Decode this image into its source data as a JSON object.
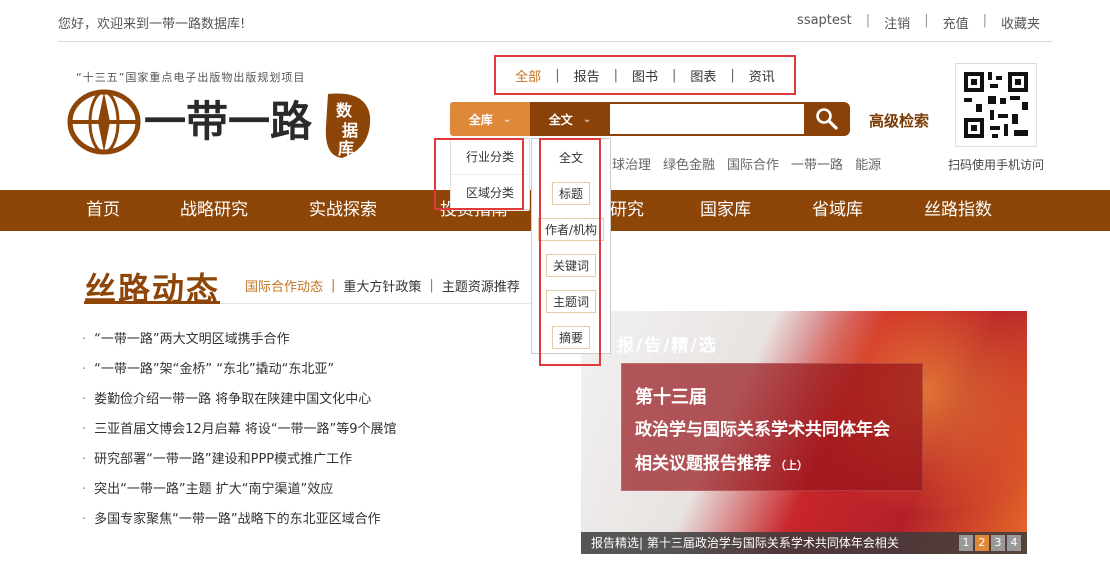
{
  "topbar": {
    "welcome": "您好，欢迎来到一带一路数据库!",
    "links": [
      "ssaptest",
      "注销",
      "充值",
      "收藏夹"
    ]
  },
  "logo": {
    "subtitle": "“十三五”国家重点电子出版物出版规划项目",
    "text": "一带一路",
    "tag": "数据库"
  },
  "search": {
    "types": [
      "全部",
      "报告",
      "图书",
      "图表",
      "资讯"
    ],
    "active_type": "全部",
    "library_label": "全库",
    "field_label": "全文",
    "input_value": "",
    "advanced_label": "高级检索",
    "hot_keywords": [
      "球治理",
      "绿色金融",
      "国际合作",
      "一带一路",
      "能源"
    ]
  },
  "dropdowns": {
    "library_options": [
      "行业分类",
      "区域分类"
    ],
    "field_options": [
      "全文",
      "标题",
      "作者/机构",
      "关键词",
      "主题词",
      "摘要"
    ]
  },
  "qr": {
    "label": "扫码使用手机访问"
  },
  "nav": {
    "items": [
      "首页",
      "战略研究",
      "实战探索",
      "投资指南",
      "研究",
      "国家库",
      "省域库",
      "丝路指数"
    ]
  },
  "section": {
    "title": "丝路动态",
    "tabs": [
      "国际合作动态",
      "重大方针政策",
      "主题资源推荐"
    ],
    "news": [
      "“一带一路”两大文明区域携手合作",
      "“一带一路”架“金桥” “东北”撬动“东北亚”",
      "娄勤俭介绍一带一路 将争取在陕建中国文化中心",
      "三亚首届文博会12月启幕 将设“一带一路”等9个展馆",
      "研究部署“一带一路”建设和PPP模式推广工作",
      "突出“一带一路”主题 扩大“南宁渠道”效应",
      "多国专家聚焦“一带一路”战略下的东北亚区域合作"
    ]
  },
  "banner": {
    "header": "报/告/精/选",
    "line1": "第十三届",
    "line2": "政治学与国际关系学术共同体年会",
    "line3": "相关议题报告推荐",
    "line3_small": "（上）",
    "caption": "报告精选| 第十三届政治学与国际关系学术共同体年会相关",
    "pages": [
      "1",
      "2",
      "3",
      "4"
    ],
    "active_page": "2"
  },
  "colors": {
    "brand": "#8e4508",
    "accent": "#e0883a",
    "highlight": "#e03a3a"
  }
}
